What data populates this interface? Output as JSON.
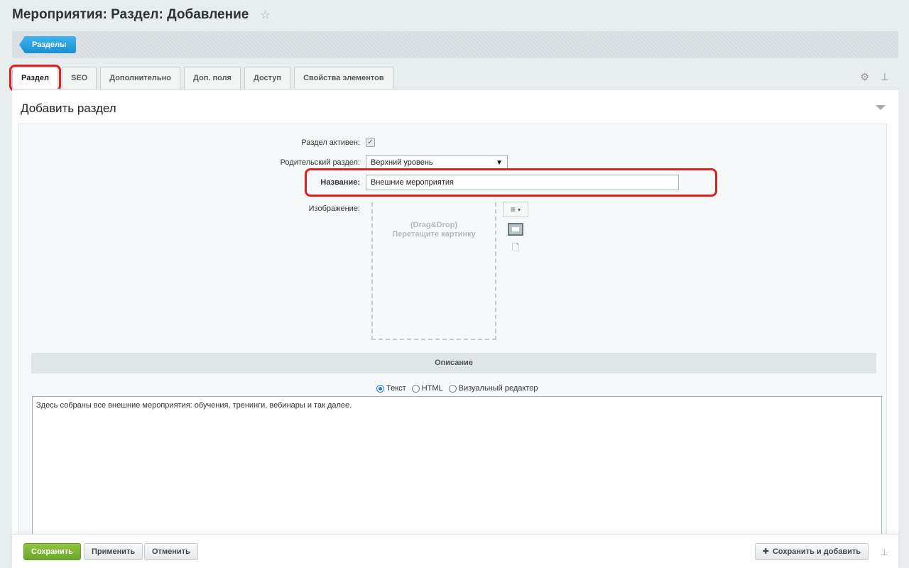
{
  "header": {
    "title": "Мероприятия: Раздел: Добавление",
    "star_icon": "star-icon"
  },
  "breadcrumb": {
    "sections_label": "Разделы"
  },
  "tabs": [
    {
      "label": "Раздел",
      "active": true
    },
    {
      "label": "SEO"
    },
    {
      "label": "Дополнительно"
    },
    {
      "label": "Доп. поля"
    },
    {
      "label": "Доступ"
    },
    {
      "label": "Свойства элементов"
    }
  ],
  "panel": {
    "heading": "Добавить раздел"
  },
  "form": {
    "active_label": "Раздел активен:",
    "active_checked": true,
    "parent_label": "Родительский раздел:",
    "parent_value": "Верхний уровень",
    "name_label": "Название:",
    "name_value": "Внешние мероприятия",
    "image_label": "Изображение:",
    "dropzone_line1": "(Drag&Drop)",
    "dropzone_line2": "Перетащите картинку"
  },
  "description": {
    "section_title": "Описание",
    "mode_options": [
      "Текст",
      "HTML",
      "Визуальный редактор"
    ],
    "selected_mode": "Текст",
    "text": "Здесь собраны все внешние мероприятия: обучения, тренинги, вебинары и так далее."
  },
  "footer": {
    "save": "Сохранить",
    "apply": "Применить",
    "cancel": "Отменить",
    "save_add": "Сохранить и добавить"
  },
  "colors": {
    "accent_blue": "#1b8fd3",
    "save_green": "#7ab834",
    "highlight_red": "#e01f1f"
  }
}
